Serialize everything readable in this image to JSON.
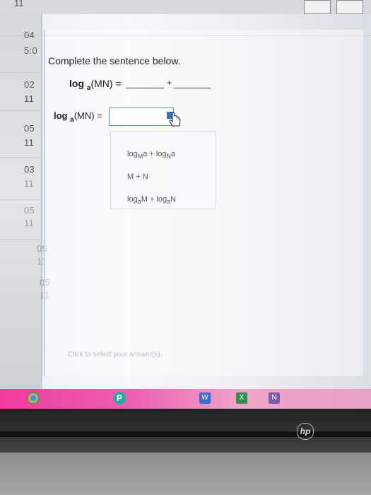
{
  "topbar": {
    "number": "11"
  },
  "left_column": {
    "rows": [
      {
        "top": "04",
        "bottom": "5:0"
      },
      {
        "top": "02",
        "bottom": "11"
      },
      {
        "top": "05",
        "bottom": "11"
      },
      {
        "top": "03",
        "bottom": "11"
      },
      {
        "top": "05",
        "bottom": "11"
      },
      {
        "top": "05",
        "bottom": "11"
      },
      {
        "top": "05",
        "bottom": "11"
      }
    ]
  },
  "question": {
    "instruction": "Complete the sentence below.",
    "line1": {
      "prefix": "log",
      "base": "a",
      "arg": "(MN) =",
      "plus": "+"
    },
    "line2": {
      "prefix": "log",
      "base": "a",
      "arg": "(MN) ="
    }
  },
  "dropdown": {
    "options": [
      {
        "text": "logMa + logNa"
      },
      {
        "text": "M + N"
      },
      {
        "text": "logaM + logaN"
      }
    ]
  },
  "hint": "Click to select your answer(s).",
  "taskbar": {
    "icons": [
      "chrome-icon",
      "p-icon",
      "word-icon",
      "excel-icon",
      "onenote-icon"
    ],
    "p_label": "P",
    "w_label": "W",
    "x_label": "X",
    "n_label": "N"
  },
  "bezel": {
    "logo": "hp"
  }
}
